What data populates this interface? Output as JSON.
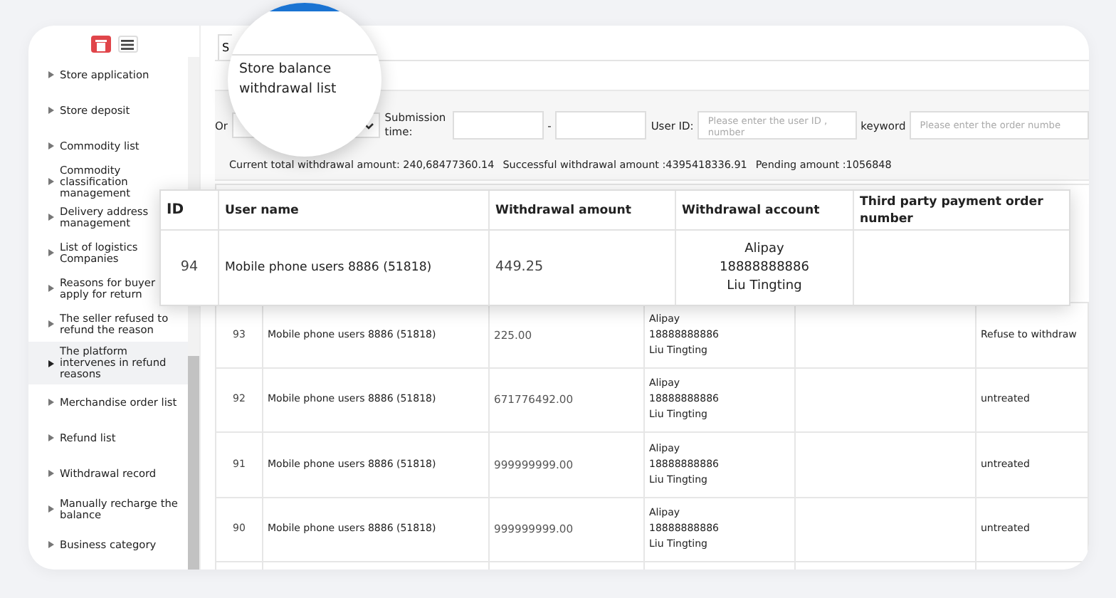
{
  "sidebar": {
    "items": [
      {
        "label": "Store application",
        "selected": false
      },
      {
        "label": "Store deposit",
        "selected": false
      },
      {
        "label": "Commodity list",
        "selected": false
      },
      {
        "label": "Commodity classification management",
        "selected": false
      },
      {
        "label": "Delivery address management",
        "selected": false
      },
      {
        "label": "List of logistics Companies",
        "selected": false
      },
      {
        "label": "Reasons for buyer apply for return",
        "selected": false
      },
      {
        "label": "The seller refused to refund the reason",
        "selected": false
      },
      {
        "label": "The platform intervenes in refund reasons",
        "selected": true
      },
      {
        "label": "Merchandise order list",
        "selected": false
      },
      {
        "label": "Refund list",
        "selected": false
      },
      {
        "label": "Withdrawal record",
        "selected": false
      },
      {
        "label": "Manually recharge the balance",
        "selected": false
      },
      {
        "label": "Business category",
        "selected": false
      }
    ]
  },
  "tab": {
    "label": "S"
  },
  "magnifier": {
    "title": "Store balance withdrawal list"
  },
  "filters": {
    "order_label": "Or",
    "time_label": "Submission time:",
    "range_separator": "-",
    "user_id_label": "User ID:",
    "user_id_placeholder": "Please enter the user ID , number",
    "keyword_label": "keyword",
    "keyword_placeholder": "Please enter the order numbe"
  },
  "summary": [
    "Current total withdrawal amount: 240,68477360.14",
    "Successful withdrawal amount :4395418336.91",
    "Pending amount :1056848"
  ],
  "highlight_table": {
    "columns": [
      "ID",
      "User name",
      "Withdrawal amount",
      "Withdrawal account",
      "Third party payment order number"
    ],
    "row": {
      "id": "94",
      "user": "Mobile phone users 8886 (51818)",
      "amount": "449.25",
      "account": [
        "Alipay",
        "18888888886",
        "Liu Tingting"
      ]
    }
  },
  "table": {
    "rows": [
      {
        "id": "93",
        "user": "Mobile phone users 8886 (51818)",
        "amount": "225.00",
        "account": [
          "Alipay",
          "18888888886",
          "Liu Tingting"
        ],
        "status": "Refuse to withdraw"
      },
      {
        "id": "92",
        "user": "Mobile phone users 8886 (51818)",
        "amount": "671776492.00",
        "account": [
          "Alipay",
          "18888888886",
          "Liu Tingting"
        ],
        "status": "untreated"
      },
      {
        "id": "91",
        "user": "Mobile phone users 8886 (51818)",
        "amount": "999999999.00",
        "account": [
          "Alipay",
          "18888888886",
          "Liu Tingting"
        ],
        "status": "untreated"
      },
      {
        "id": "90",
        "user": "Mobile phone users 8886 (51818)",
        "amount": "999999999.00",
        "account": [
          "Alipay",
          "18888888886",
          "Liu Tingting"
        ],
        "status": "untreated"
      }
    ]
  }
}
